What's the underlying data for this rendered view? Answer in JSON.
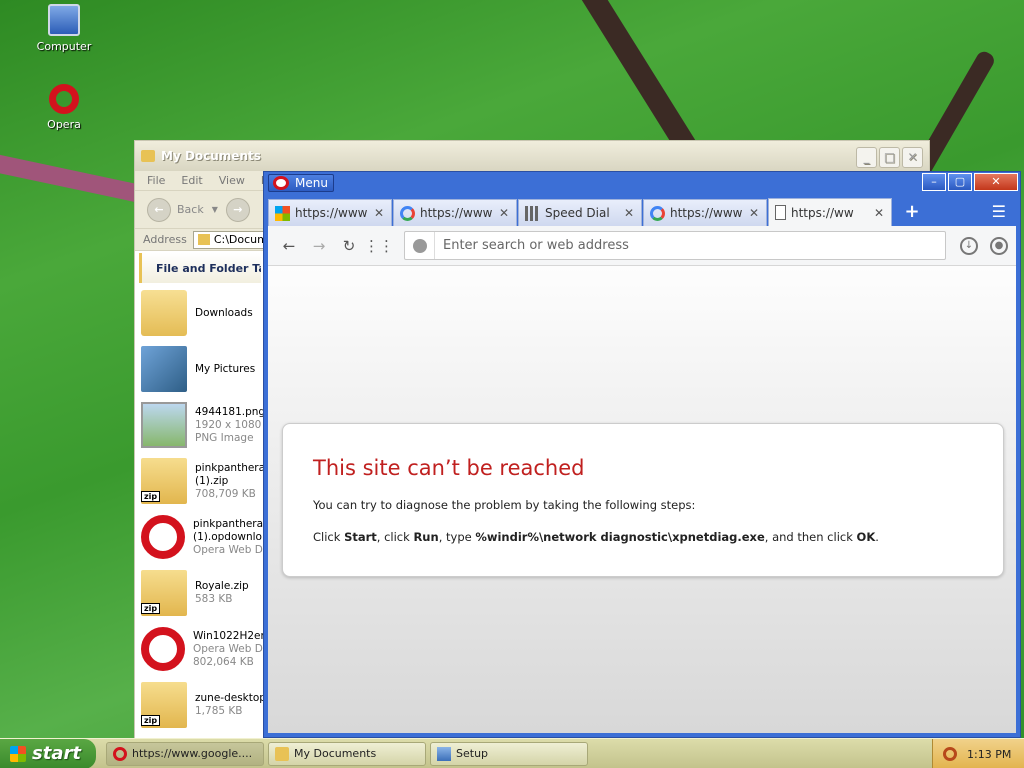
{
  "desktop": {
    "icons": [
      {
        "label": "Computer",
        "icon": "computer-icon"
      },
      {
        "label": "Opera",
        "icon": "opera-icon"
      }
    ]
  },
  "explorer": {
    "title": "My Documents",
    "menu": [
      "File",
      "Edit",
      "View",
      "Fa"
    ],
    "back_label": "Back",
    "address_label": "Address",
    "address_value": "C:\\Docume",
    "task_pane_title": "File and Folder Tasl",
    "files": [
      {
        "name": "Downloads",
        "lines": [],
        "icon": "folder-icon"
      },
      {
        "name": "My Pictures",
        "lines": [],
        "icon": "pictures-folder-icon"
      },
      {
        "name": "4944181.png",
        "lines": [
          "1920 x 1080",
          "PNG Image"
        ],
        "icon": "png-file-icon"
      },
      {
        "name": "pinkpantherar",
        "lines": [
          "(1).zip",
          "708,709 KB"
        ],
        "icon": "zip-file-icon"
      },
      {
        "name": "pinkpantherar",
        "lines": [
          "(1).opdownlo",
          "Opera Web D"
        ],
        "icon": "opera-file-icon"
      },
      {
        "name": "Royale.zip",
        "lines": [
          "583 KB"
        ],
        "icon": "zip-file-icon"
      },
      {
        "name": "Win1022H2en",
        "lines": [
          "Opera Web Do",
          "802,064 KB"
        ],
        "icon": "opera-file-icon"
      },
      {
        "name": "zune-desktop-",
        "lines": [
          "1,785 KB"
        ],
        "icon": "zip-file-icon"
      }
    ]
  },
  "opera": {
    "menu_label": "Menu",
    "tabs": [
      {
        "label": "https://www",
        "favicon": "microsoft-favicon",
        "active": false
      },
      {
        "label": "https://www",
        "favicon": "google-favicon",
        "active": false
      },
      {
        "label": "Speed Dial",
        "favicon": "speed-dial-favicon",
        "active": false
      },
      {
        "label": "https://www",
        "favicon": "google-favicon",
        "active": false
      },
      {
        "label": "https://ww",
        "favicon": "page-favicon",
        "active": true
      }
    ],
    "url_placeholder": "Enter search or web address",
    "error": {
      "title": "This site can’t be reached",
      "line1": "You can try to diagnose the problem by taking the following steps:",
      "line2_parts": [
        "Click ",
        "Start",
        ", click ",
        "Run",
        ", type ",
        "%windir%\\network diagnostic\\xpnetdiag.exe",
        ", and then click ",
        "OK",
        "."
      ]
    }
  },
  "taskbar": {
    "start_label": "start",
    "items": [
      {
        "label": "https://www.google....",
        "icon": "opera-icon",
        "active": true
      },
      {
        "label": "My Documents",
        "icon": "folder-icon",
        "active": false
      },
      {
        "label": "Setup",
        "icon": "setup-icon",
        "active": false
      }
    ],
    "clock": "1:13 PM"
  }
}
